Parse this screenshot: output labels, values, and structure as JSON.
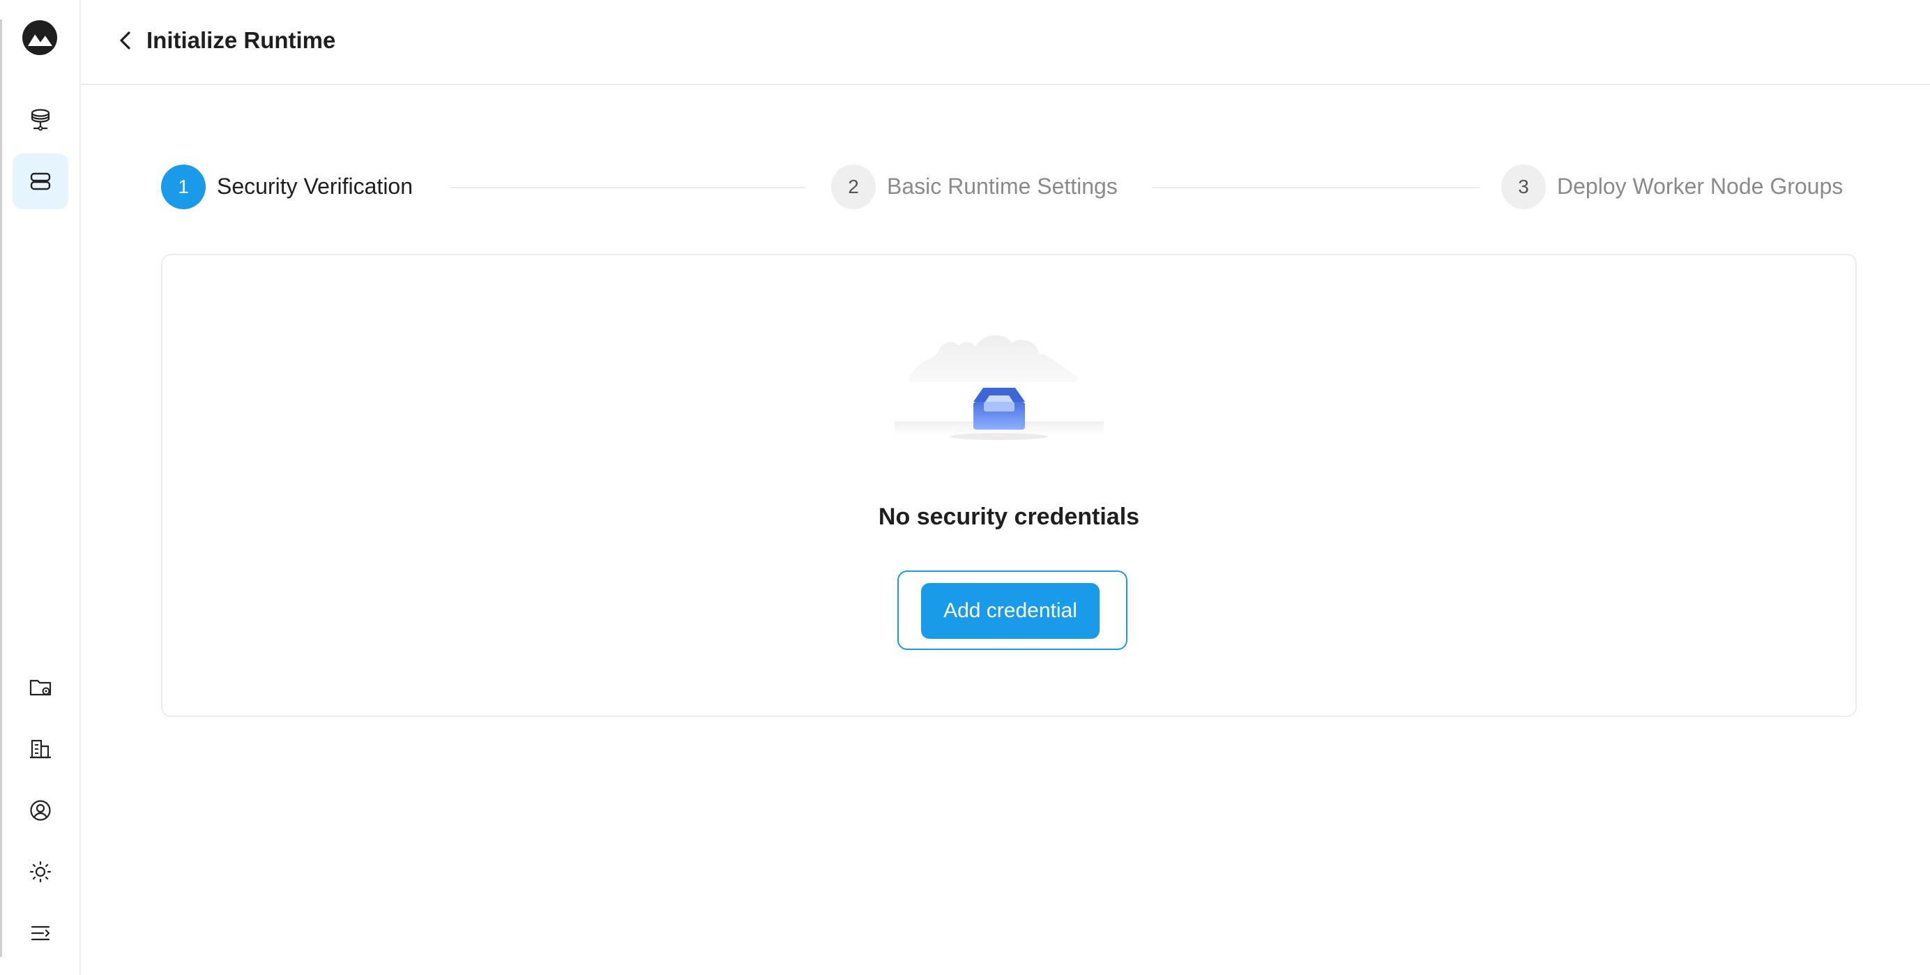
{
  "header": {
    "title": "Initialize Runtime"
  },
  "sidebar": {
    "top_items": [
      {
        "icon": "database-network-icon",
        "active": false
      },
      {
        "icon": "server-stack-icon",
        "active": true
      }
    ],
    "bottom_items": [
      {
        "icon": "folder-settings-icon"
      },
      {
        "icon": "building-icon"
      },
      {
        "icon": "user-circle-icon"
      },
      {
        "icon": "sun-icon"
      },
      {
        "icon": "menu-collapse-icon"
      }
    ]
  },
  "steps": [
    {
      "number": "1",
      "label": "Security Verification",
      "status": "active"
    },
    {
      "number": "2",
      "label": "Basic Runtime Settings",
      "status": "inactive"
    },
    {
      "number": "3",
      "label": "Deploy Worker Node Groups",
      "status": "inactive"
    }
  ],
  "empty_state": {
    "title": "No security credentials",
    "button_label": "Add credential"
  },
  "colors": {
    "accent": "#1a9bea",
    "active_nav_bg": "#e6f5fd",
    "inactive_step": "#efefef"
  }
}
